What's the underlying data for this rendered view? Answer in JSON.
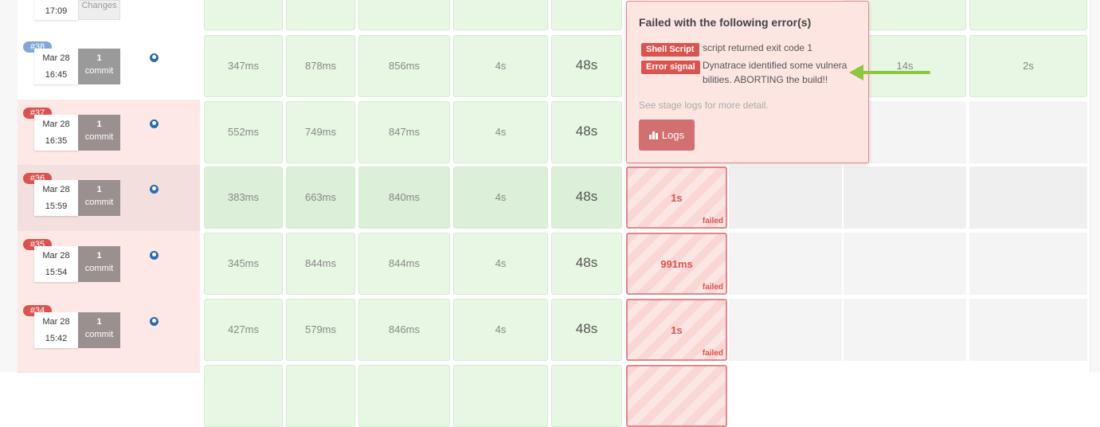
{
  "builds": [
    {
      "number": "#38",
      "date": "Mar 28",
      "time": "16:45",
      "commit_count": "1",
      "commit_label": "commit"
    },
    {
      "number": "#37",
      "date": "Mar 28",
      "time": "16:35",
      "commit_count": "1",
      "commit_label": "commit"
    },
    {
      "number": "#36",
      "date": "Mar 28",
      "time": "15:59",
      "commit_count": "1",
      "commit_label": "commit"
    },
    {
      "number": "#35",
      "date": "Mar 28",
      "time": "15:54",
      "commit_count": "1",
      "commit_label": "commit"
    },
    {
      "number": "#34",
      "date": "Mar 28",
      "time": "15:42",
      "commit_count": "1",
      "commit_label": "commit"
    }
  ],
  "top_partial": {
    "time": "17:09",
    "changes": "Changes"
  },
  "stage_times": [
    [
      "347ms",
      "878ms",
      "856ms",
      "4s",
      "48s",
      "",
      "14s",
      "2s"
    ],
    [
      "552ms",
      "749ms",
      "847ms",
      "4s",
      "48s",
      "1s"
    ],
    [
      "383ms",
      "663ms",
      "840ms",
      "4s",
      "48s",
      "1s"
    ],
    [
      "345ms",
      "844ms",
      "844ms",
      "4s",
      "48s",
      "991ms"
    ],
    [
      "427ms",
      "579ms",
      "846ms",
      "4s",
      "48s",
      "1s"
    ]
  ],
  "failed_tag": "failed",
  "popup": {
    "title": "Failed with the following error(s)",
    "errors": [
      {
        "label": "Shell Script",
        "text": "script returned exit code 1"
      },
      {
        "label": "Error signal",
        "text_line1": "Dynatrace identified some vulnera",
        "text_line2": "bilities. ABORTING the build!!"
      }
    ],
    "hint": "See stage logs for more detail.",
    "logs_button": "Logs"
  },
  "colors": {
    "accent_red": "#d9534f",
    "arrow_green": "#8dc63f",
    "cell_green": "#e7f7e3"
  }
}
